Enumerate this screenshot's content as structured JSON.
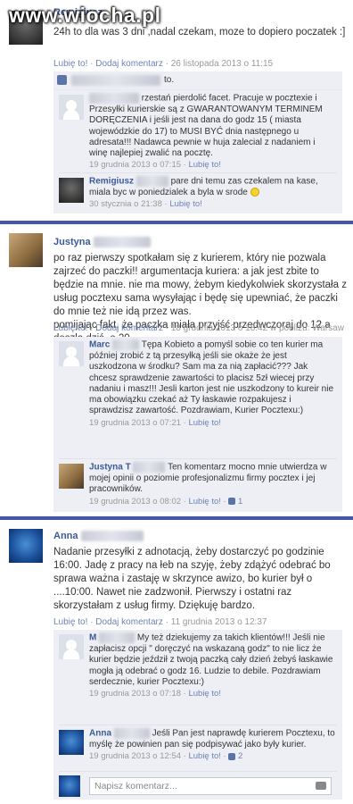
{
  "watermark": "www.wiocha.pl",
  "posts": [
    {
      "author": "Remigiusz",
      "text": "24h to dla was 3 dni ,nadal czekam, moze to dopiero poczatek :]",
      "meta_like": "Lubię to!",
      "meta_comment": "Dodaj komentarz",
      "meta_date": "26 listopada 2013 o 11:15",
      "likes_text": "to.",
      "comments": [
        {
          "text": "rzestań pierdolić facet. Pracuje w pocztexie i Przesyłki kurierskie są z GWARANTOWANYM TERMINEM DORĘCZENIA i jeśli jest na dana do godz 15 ( miasta wojewódzkie do 17) to MUSI BYĆ dnia następnego u adresata!!! Nadawca pewnie w huja zalecial z nadaniem i winę najlepiej zwalić na pocztę.",
          "date": "19 grudnia 2013 o 07:15",
          "like": "Lubię to!"
        },
        {
          "name": "Remigiusz",
          "text": "pare dni temu zas czekalem na kase, miala byc w poniedzialek a byla w srode",
          "date": "30 stycznia o 21:38",
          "like": "Lubię to!"
        }
      ]
    },
    {
      "author": "Justyna",
      "text": "po raz pierwszy spotkałam się z kurierem, który nie pozwala zajrzeć do paczki!! argumentacja kuriera: a jak jest zbite to będzie na mnie. nie ma mowy, żebym kiedykolwiek skorzystała z usług pocztexu sama wysyłając i będę się upewniać, że paczki do mnie też nie idą przez was.\npomijając fakt, że paczka miała przyjść przedwczoraj do 12 a doszła dziś, o 20.",
      "meta_like": "Lubię to!",
      "meta_comment": "Dodaj komentarz",
      "meta_date": "18 grudnia 2013 o 18:42 w pobliżu: Warsaw",
      "comments": [
        {
          "name": "Marc",
          "text": "Tępa Kobieto a pomyśl sobie co ten kurier ma później zrobić z tą przesyłką jeśli sie okaże że jest uszkodzona w środku? Sam ma za nią zapłacić??? Jak chcesz sprawdzenie zawartości to placisz 5zł wiecej przy nadaniu i masz!!! Jesli karton jest nie uszkodzony to kureir nie ma obowiązku czekać aż Ty łaskawie rozpakujesz i sprawdzisz zawartość. Pozdrawiam, Kurier Pocztexu:)",
          "date": "19 grudnia 2013 o 07:21",
          "like": "Lubię to!"
        },
        {
          "name": "Justyna T",
          "text": "Ten komentarz mocno mnie utwierdza w mojej opinii o poziomie profesjonalizmu firmy pocztex i jej pracowników.",
          "date": "19 grudnia 2013 o 08:02",
          "like": "Lubię to!",
          "like_count": "1"
        }
      ]
    },
    {
      "author": "Anna",
      "text": "Nadanie przesyłki z adnotacją, żeby dostarczyć po godzinie 16:00. Jadę z pracy na łeb na szyję, żeby zdążyć odebrać bo sprawa ważna i zastaję w skrzynce awizo, bo kurier był o ....10:00. Nawet nie zadzwonił. Pierwszy i ostatni raz skorzystałam z usług firmy. Dziękuję bardzo.",
      "meta_like": "Lubię to!",
      "meta_comment": "Dodaj komentarz",
      "meta_date": "11 grudnia 2013 o 12:37",
      "comments": [
        {
          "name": "M",
          "text": "My też dziekujemy za takich klientów!!! Jeśli nie zapłacisz opcji \" doręczyć na wskazaną godz\" to nie licz że kurier będzie jeździł z twoją paczką cały dzień żebyś łaskawie mogła ją odebrać o godz 16. Ludzie to debile. Pozdrawiam serdecznie, kurier Pocztexu:)",
          "date": "19 grudnia 2013 o 07:18",
          "like": "Lubię to!"
        },
        {
          "name": "Anna",
          "text": "Jeśli Pan jest naprawdę kurierem Pocztexu, to myślę że powinien pan się podpisywać jako były kurier.",
          "date": "19 grudnia 2013 o 12:54",
          "like": "Lubię to!",
          "like_count": "2"
        }
      ],
      "input_placeholder": "Napisz komentarz..."
    }
  ],
  "colors": {
    "link": "#3b5998",
    "separator": "#4458a8",
    "comment_bg": "#edeff4"
  }
}
